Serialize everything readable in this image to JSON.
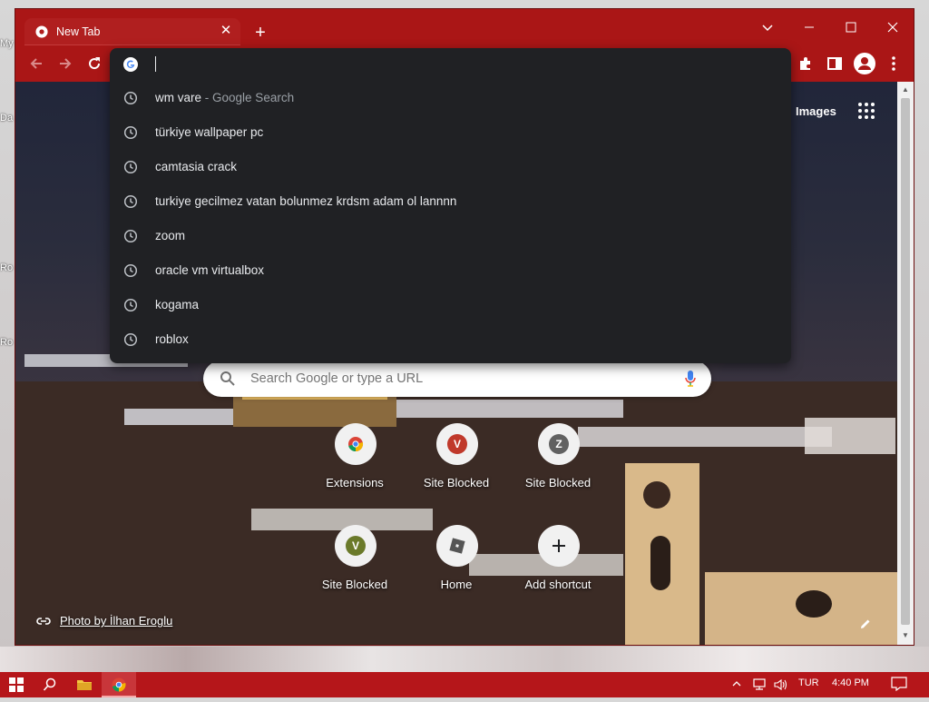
{
  "desktop": {
    "side_labels": [
      "My",
      "Da",
      "Ro",
      "Ro"
    ]
  },
  "browser": {
    "tab": {
      "title": "New Tab"
    },
    "colors": {
      "frame": "#aa1616",
      "omnibox_bg": "#202124",
      "taskbar": "#b5161a"
    }
  },
  "omnibox": {
    "input_value": "",
    "suggestions": [
      {
        "text": "wm vare",
        "sub": "- Google Search"
      },
      {
        "text": "türkiye wallpaper pc",
        "sub": ""
      },
      {
        "text": "camtasia crack",
        "sub": ""
      },
      {
        "text": "turkiye gecilmez vatan bolunmez krdsm adam ol lannnn",
        "sub": ""
      },
      {
        "text": "zoom",
        "sub": ""
      },
      {
        "text": "oracle vm virtualbox",
        "sub": ""
      },
      {
        "text": "kogama",
        "sub": ""
      },
      {
        "text": "roblox",
        "sub": ""
      }
    ]
  },
  "ntp": {
    "images_link": "Images",
    "search_placeholder": "Search Google or type a URL",
    "shortcuts": [
      {
        "label": "Extensions",
        "icon": "chrome-icon",
        "letter": "",
        "color": ""
      },
      {
        "label": "Site Blocked",
        "icon": "letter-avatar",
        "letter": "V",
        "color": "#c0392b"
      },
      {
        "label": "Site Blocked",
        "icon": "letter-avatar",
        "letter": "Z",
        "color": "#616161"
      },
      {
        "label": "Site Blocked",
        "icon": "letter-avatar",
        "letter": "V",
        "color": "#6b7a2a"
      },
      {
        "label": "Home",
        "icon": "roblox-icon",
        "letter": "",
        "color": "#555555"
      },
      {
        "label": "Add shortcut",
        "icon": "plus-icon",
        "letter": "",
        "color": ""
      }
    ],
    "photo_credit": "Photo by İlhan Eroglu"
  },
  "taskbar": {
    "language": "TUR",
    "time": "4:40 PM"
  }
}
